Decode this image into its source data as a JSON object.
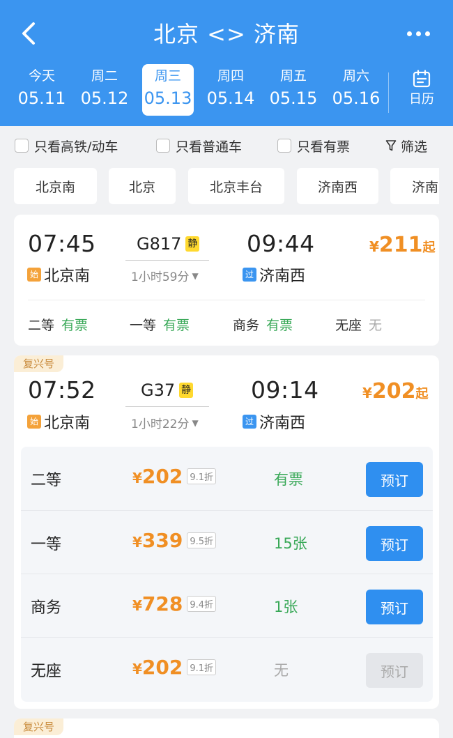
{
  "header": {
    "title": "北京 <> 济南",
    "calendar_label": "日历",
    "tabs": [
      {
        "weekday": "今天",
        "date": "05.11",
        "active": false
      },
      {
        "weekday": "周二",
        "date": "05.12",
        "active": false
      },
      {
        "weekday": "周三",
        "date": "05.13",
        "active": true
      },
      {
        "weekday": "周四",
        "date": "05.14",
        "active": false
      },
      {
        "weekday": "周五",
        "date": "05.15",
        "active": false
      },
      {
        "weekday": "周六",
        "date": "05.16",
        "active": false
      }
    ]
  },
  "filters": {
    "high_speed": "只看高铁/动车",
    "normal": "只看普通车",
    "available": "只看有票",
    "filter": "筛选"
  },
  "stations": [
    "北京南",
    "北京",
    "北京丰台",
    "济南西",
    "济南"
  ],
  "trains": [
    {
      "tag": "",
      "depart_time": "07:45",
      "depart_mark": "始",
      "depart_station": "北京南",
      "train_no": "G817",
      "quiet": "静",
      "duration": "1小时59分",
      "arrive_time": "09:44",
      "arrive_mark": "过",
      "arrive_station": "济南西",
      "price_yen": "¥",
      "price": "211",
      "price_suffix": "起",
      "seats": [
        {
          "name": "二等",
          "status": "有票"
        },
        {
          "name": "一等",
          "status": "有票"
        },
        {
          "name": "商务",
          "status": "有票"
        },
        {
          "name": "无座",
          "status": "无"
        }
      ]
    },
    {
      "tag": "复兴号",
      "depart_time": "07:52",
      "depart_mark": "始",
      "depart_station": "北京南",
      "train_no": "G37",
      "quiet": "静",
      "duration": "1小时22分",
      "arrive_time": "09:14",
      "arrive_mark": "过",
      "arrive_station": "济南西",
      "price_yen": "¥",
      "price": "202",
      "price_suffix": "起",
      "seat_details": [
        {
          "name": "二等",
          "yen": "¥",
          "price": "202",
          "discount": "9.1折",
          "status": "有票",
          "book": "预订",
          "enabled": true
        },
        {
          "name": "一等",
          "yen": "¥",
          "price": "339",
          "discount": "9.5折",
          "status": "15张",
          "book": "预订",
          "enabled": true
        },
        {
          "name": "商务",
          "yen": "¥",
          "price": "728",
          "discount": "9.4折",
          "status": "1张",
          "book": "预订",
          "enabled": true
        },
        {
          "name": "无座",
          "yen": "¥",
          "price": "202",
          "discount": "9.1折",
          "status": "无",
          "book": "预订",
          "enabled": false
        }
      ]
    },
    {
      "tag": "复兴号"
    }
  ],
  "colors": {
    "primary": "#3b95f0",
    "price": "#f08f24",
    "available": "#38a857",
    "tag_bg": "#fbeed6"
  }
}
